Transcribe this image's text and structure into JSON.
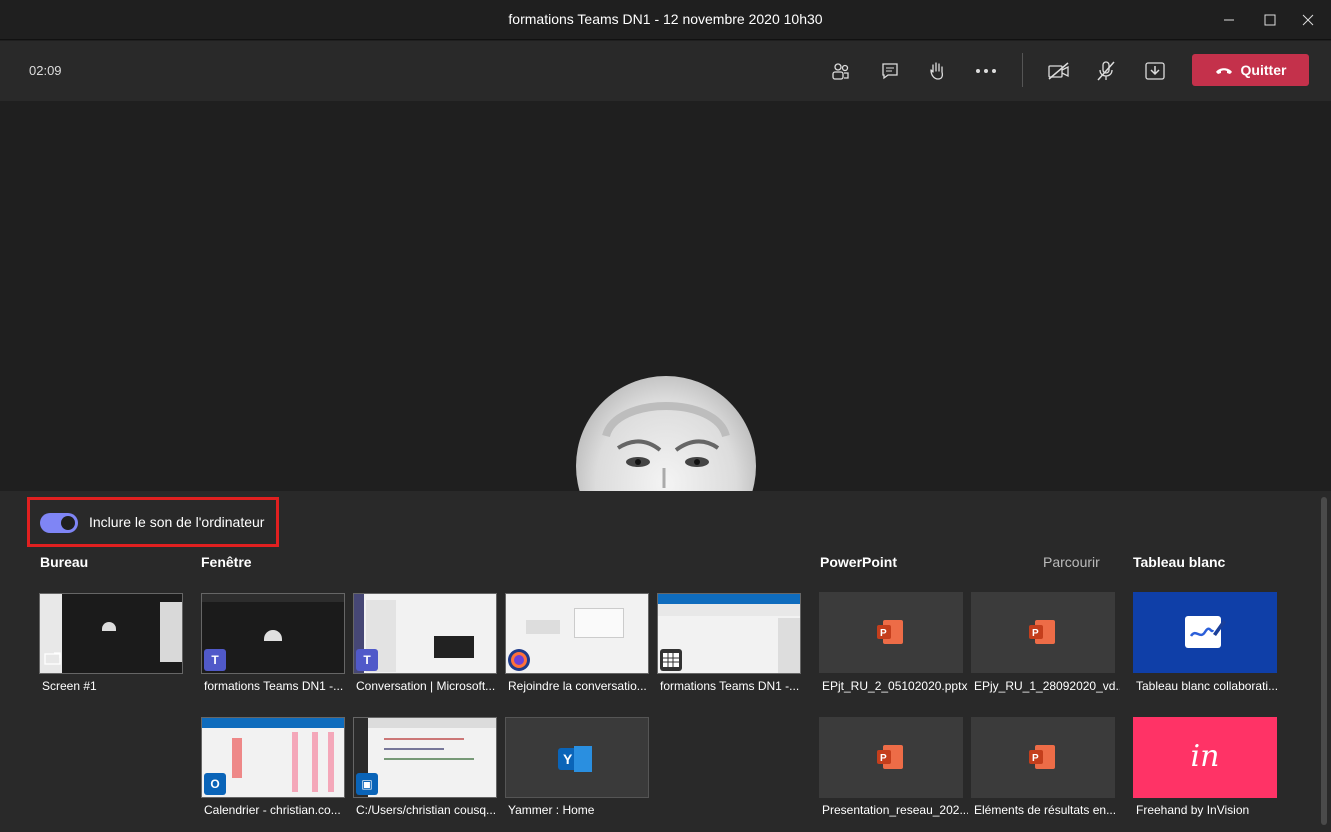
{
  "window": {
    "title": "formations Teams DN1 - 12 novembre 2020 10h30"
  },
  "meeting": {
    "timer": "02:09",
    "leave_label": "Quitter"
  },
  "share": {
    "include_audio_label": "Inclure le son de l'ordinateur",
    "include_audio_on": true,
    "sections": {
      "desktop": "Bureau",
      "window": "Fenêtre",
      "powerpoint": "PowerPoint",
      "browse": "Parcourir",
      "whiteboard": "Tableau blanc"
    },
    "desktop_items": [
      {
        "label": "Screen #1"
      }
    ],
    "window_items": [
      {
        "label": "formations Teams DN1 -..."
      },
      {
        "label": "Conversation | Microsoft..."
      },
      {
        "label": "Rejoindre la conversatio..."
      },
      {
        "label": "formations Teams DN1 -..."
      },
      {
        "label": "Calendrier - christian.co..."
      },
      {
        "label": "C:/Users/christian cousq..."
      },
      {
        "label": "Yammer : Home"
      }
    ],
    "powerpoint_items": [
      {
        "label": "EPjt_RU_2_05102020.pptx"
      },
      {
        "label": "EPjy_RU_1_28092020_vd...."
      },
      {
        "label": "Presentation_reseau_202..."
      },
      {
        "label": "Eléments de résultats en..."
      }
    ],
    "whiteboard_items": [
      {
        "label": "Tableau blanc collaborati..."
      },
      {
        "label": "Freehand by InVision"
      }
    ]
  },
  "colors": {
    "accent": "#7f85f5",
    "leave": "#c4314b",
    "highlight": "#e02020",
    "whiteboard_bg": "#0f3fa8",
    "invision_bg": "#ff3366"
  }
}
